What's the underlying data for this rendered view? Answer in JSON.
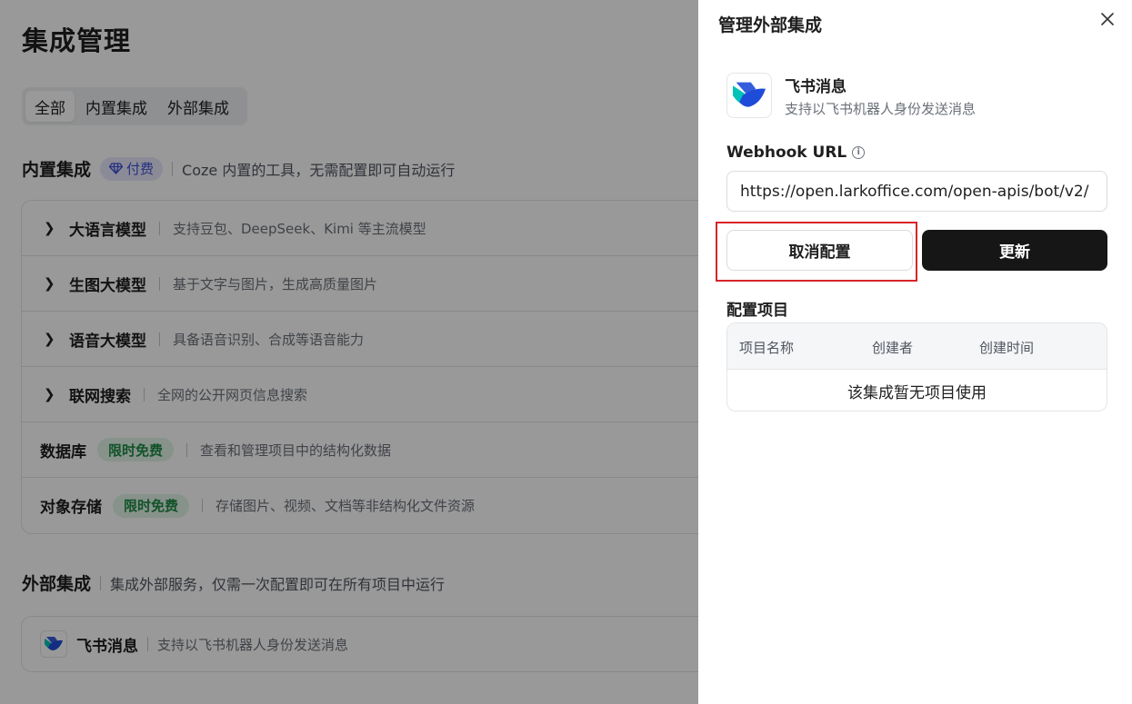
{
  "page": {
    "title": "集成管理",
    "tabs": [
      {
        "label": "全部",
        "active": true
      },
      {
        "label": "内置集成",
        "active": false
      },
      {
        "label": "外部集成",
        "active": false
      }
    ],
    "builtin": {
      "heading": "内置集成",
      "badge": "付费",
      "badge_icon": "diamond-icon",
      "description": "Coze 内置的工具，无需配置即可自动运行",
      "rows": [
        {
          "title": "大语言模型",
          "desc": "支持豆包、DeepSeek、Kimi 等主流模型"
        },
        {
          "title": "生图大模型",
          "desc": "基于文字与图片，生成高质量图片"
        },
        {
          "title": "语音大模型",
          "desc": "具备语音识别、合成等语音能力"
        },
        {
          "title": "联网搜索",
          "desc": "全网的公开网页信息搜索"
        },
        {
          "title": "数据库",
          "badge": "限时免费",
          "desc": "查看和管理项目中的结构化数据"
        },
        {
          "title": "对象存储",
          "badge": "限时免费",
          "desc": "存储图片、视频、文档等非结构化文件资源"
        }
      ]
    },
    "external": {
      "heading": "外部集成",
      "description": "集成外部服务，仅需一次配置即可在所有项目中运行",
      "item": {
        "title": "飞书消息",
        "desc": "支持以飞书机器人身份发送消息"
      }
    }
  },
  "drawer": {
    "title": "管理外部集成",
    "integration": {
      "name": "飞书消息",
      "desc": "支持以飞书机器人身份发送消息",
      "icon": "feishu-logo-icon"
    },
    "webhook_label": "Webhook URL",
    "webhook_value": "https://open.larkoffice.com/open-apis/bot/v2/",
    "cancel_label": "取消配置",
    "update_label": "更新",
    "config_label": "配置项目",
    "table_headers": [
      "项目名称",
      "创建者",
      "创建时间"
    ],
    "table_empty": "该集成暂无项目使用"
  },
  "colors": {
    "paid_badge_bg": "#e6e8fb",
    "paid_badge_text": "#4050d8",
    "free_badge_bg": "#e2f4e8",
    "free_badge_text": "#1e8a44",
    "primary_button": "#161616",
    "highlight": "#d9232a"
  }
}
